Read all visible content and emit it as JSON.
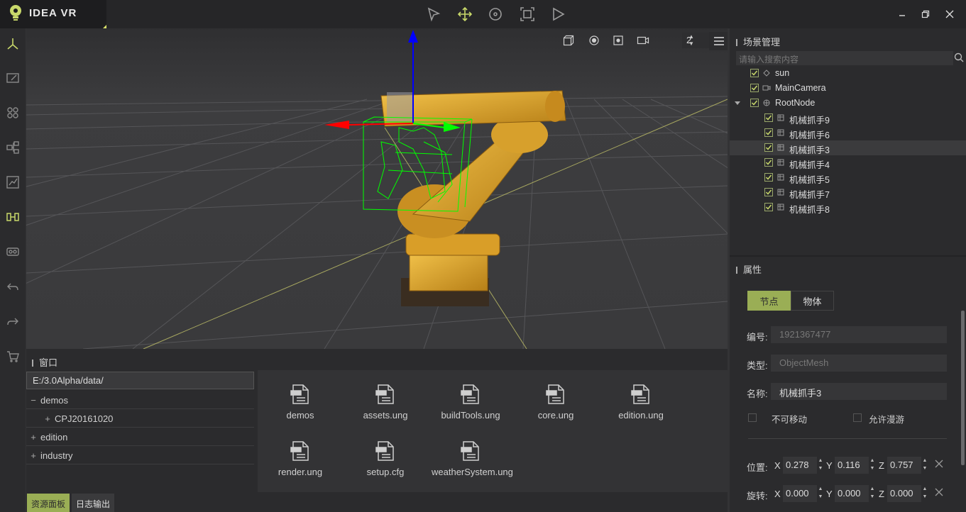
{
  "app": {
    "title": "IDEA VR"
  },
  "toolbar": {
    "tools": [
      "select-icon",
      "move-icon",
      "rotate-icon",
      "scale-icon",
      "play-icon"
    ]
  },
  "window_controls": [
    "minimize-icon",
    "restore-icon",
    "close-icon"
  ],
  "left_sidebar": [
    "axis-icon",
    "edit-icon",
    "grid-icon",
    "hierarchy-icon",
    "chart-icon",
    "robot-icon",
    "vr-icon",
    "undo-icon",
    "redo-icon",
    "cart-icon"
  ],
  "viewport": {
    "view_count": "2"
  },
  "window_panel": {
    "title": "窗口",
    "path": "E:/3.0Alpha/data/",
    "tree": [
      {
        "expander": "−",
        "label": "demos",
        "indent": 0
      },
      {
        "expander": "+",
        "label": "CPJ20161020",
        "indent": 1
      },
      {
        "expander": "+",
        "label": "edition",
        "indent": 0
      },
      {
        "expander": "+",
        "label": "industry",
        "indent": 0
      }
    ],
    "files": [
      "demos",
      "assets.ung",
      "buildTools.ung",
      "core.ung",
      "edition.ung",
      "render.ung",
      "setup.cfg",
      "weatherSystem.ung"
    ],
    "tabs": {
      "resources": "资源面板",
      "log": "日志输出"
    }
  },
  "scene": {
    "title": "场景管理",
    "search_placeholder": "请输入搜索内容",
    "items": [
      {
        "label": "sun",
        "icon": "light-icon"
      },
      {
        "label": "MainCamera",
        "icon": "camera-icon"
      },
      {
        "label": "RootNode",
        "icon": "node-icon"
      },
      {
        "label": "机械抓手9",
        "icon": "mesh-icon"
      },
      {
        "label": "机械抓手6",
        "icon": "mesh-icon"
      },
      {
        "label": "机械抓手3",
        "icon": "mesh-icon"
      },
      {
        "label": "机械抓手4",
        "icon": "mesh-icon"
      },
      {
        "label": "机械抓手5",
        "icon": "mesh-icon"
      },
      {
        "label": "机械抓手7",
        "icon": "mesh-icon"
      },
      {
        "label": "机械抓手8",
        "icon": "mesh-icon"
      }
    ]
  },
  "properties": {
    "title": "属性",
    "tabs": {
      "node": "节点",
      "object": "物体"
    },
    "id_label": "编号:",
    "id_value": "1921367477",
    "type_label": "类型:",
    "type_value": "ObjectMesh",
    "name_label": "名称:",
    "name_value": "机械抓手3",
    "immovable": "不可移动",
    "allow_roam": "允许漫游",
    "position_label": "位置:",
    "position": {
      "x": "0.278",
      "y": "0.116",
      "z": "0.757"
    },
    "rotation_label": "旋转:",
    "rotation": {
      "x": "0.000",
      "y": "0.000",
      "z": "0.000"
    },
    "axis_x": "X",
    "axis_y": "Y",
    "axis_z": "Z"
  },
  "colors": {
    "accent": "#b3c26a",
    "selection": "#00ff00",
    "robot": "#e0a72a"
  }
}
